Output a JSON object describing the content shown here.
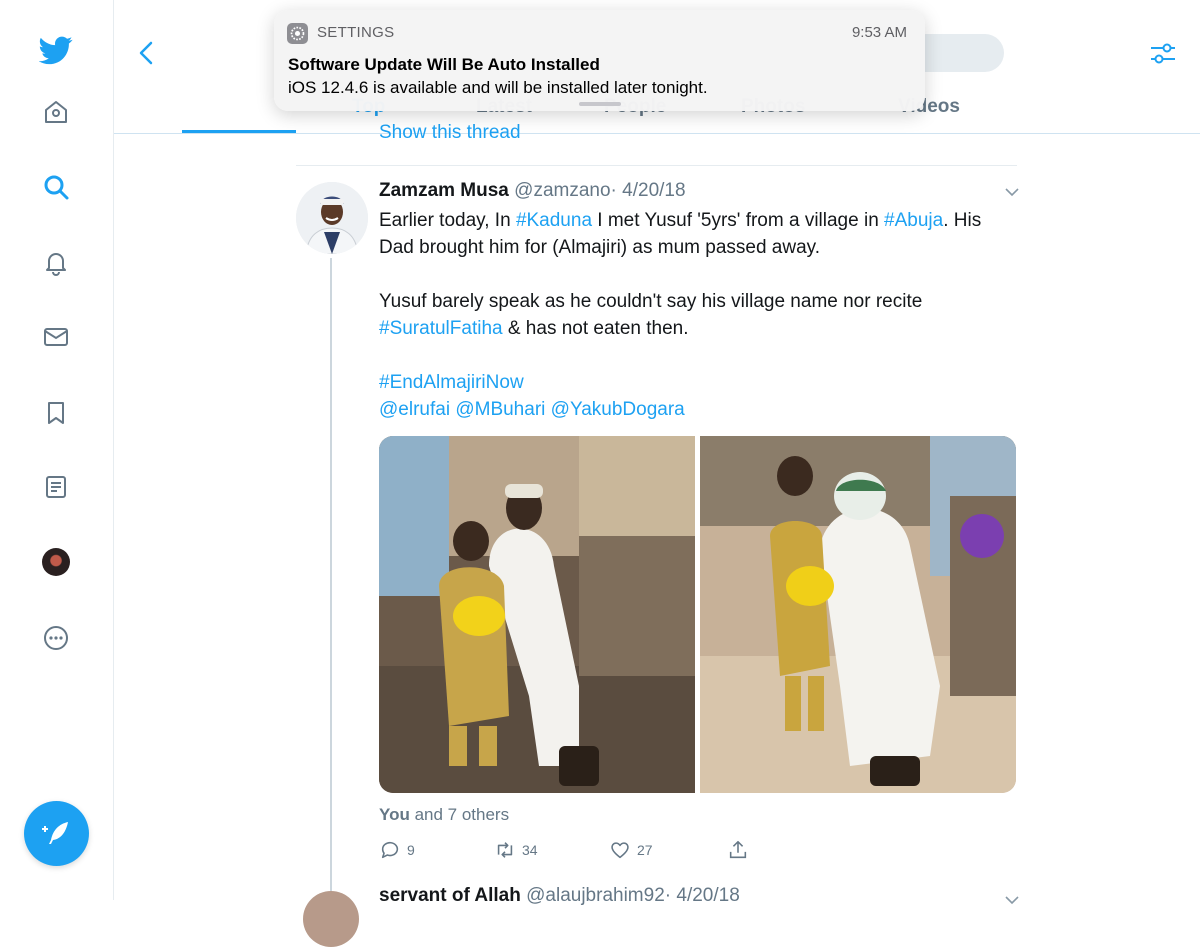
{
  "notification": {
    "app": "SETTINGS",
    "time": "9:53 AM",
    "title": "Software Update Will Be Auto Installed",
    "body": "iOS 12.4.6 is available and will be installed later tonight."
  },
  "tabs": [
    "Top",
    "Latest",
    "People",
    "Photos",
    "Videos"
  ],
  "timeline": {
    "show_thread": "Show this thread"
  },
  "tweet": {
    "name": "Zamzam Musa",
    "handle": "@zamzano",
    "date": "· 4/20/18",
    "p1_a": "Earlier today, In ",
    "p1_tag1": "#Kaduna",
    "p1_b": " I met Yusuf '5yrs' from a village in ",
    "p1_tag2": "#Abuja",
    "p1_c": ". His Dad brought him for (Almajiri) as mum passed away.",
    "p2_a": "Yusuf barely speak as he couldn't say his village name nor recite ",
    "p2_tag": "#SuratulFatiha",
    "p2_b": " & has not eaten then.",
    "p3_tag": "#EndAlmajiriNow",
    "mention1": "@elrufai",
    "mention2": "@MBuhari",
    "mention3": "@YakubDogara",
    "liked_by_you": "You",
    "liked_by_others": " and 7 others",
    "replies": "9",
    "retweets": "34",
    "likes": "27"
  },
  "next_tweet": {
    "name": "servant of Allah",
    "handle": "@alaujbrahim92",
    "date": "· 4/20/18"
  },
  "colors": {
    "accent": "#1da1f2",
    "secondary_text": "#657786",
    "border": "#e6ecf0"
  }
}
